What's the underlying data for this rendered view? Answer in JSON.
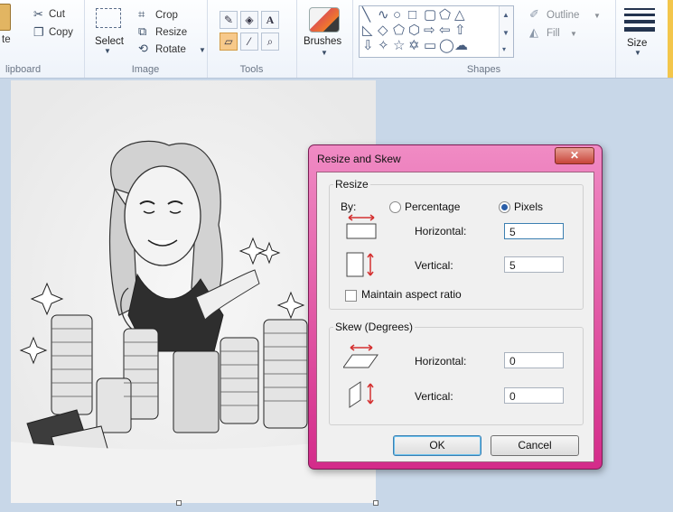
{
  "ribbon": {
    "clipboard": {
      "paste_fragment": "te",
      "cut": "Cut",
      "copy": "Copy",
      "group_label": "lipboard"
    },
    "image": {
      "select": "Select",
      "crop": "Crop",
      "resize": "Resize",
      "rotate": "Rotate",
      "group_label": "Image"
    },
    "tools": {
      "group_label": "Tools"
    },
    "brushes": {
      "label": "Brushes"
    },
    "shapes": {
      "outline": "Outline",
      "fill": "Fill",
      "group_label": "Shapes"
    },
    "size": {
      "label": "Size"
    }
  },
  "dialog": {
    "title": "Resize and Skew",
    "close": "✕",
    "resize": {
      "legend": "Resize",
      "by_label": "By:",
      "option_percentage": "Percentage",
      "option_pixels": "Pixels",
      "selected": "Pixels",
      "horizontal_label": "Horizontal:",
      "horizontal_value": "5",
      "vertical_label": "Vertical:",
      "vertical_value": "5",
      "maintain_label": "Maintain aspect ratio",
      "maintain_checked": false
    },
    "skew": {
      "legend": "Skew (Degrees)",
      "horizontal_label": "Horizontal:",
      "horizontal_value": "0",
      "vertical_label": "Vertical:",
      "vertical_value": "0"
    },
    "ok": "OK",
    "cancel": "Cancel"
  }
}
